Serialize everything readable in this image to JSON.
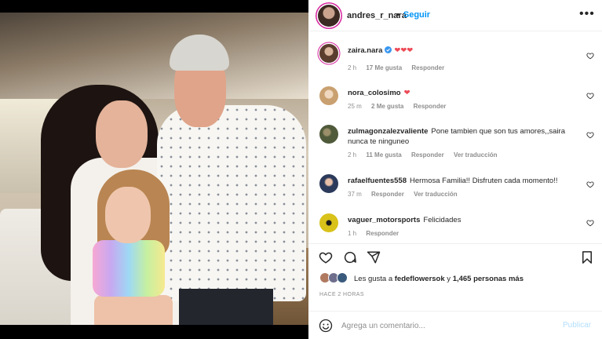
{
  "post": {
    "author": "andres_r_nara",
    "follow_label": "Seguir",
    "more_label": "•••"
  },
  "comments": [
    {
      "username": "zaira.nara",
      "text": "❤❤❤",
      "verified": true,
      "time": "2 h",
      "likes": "17 Me gusta",
      "reply": "Responder",
      "translate": ""
    },
    {
      "username": "nora_colosimo",
      "text": "❤",
      "verified": false,
      "time": "25 m",
      "likes": "2 Me gusta",
      "reply": "Responder",
      "translate": ""
    },
    {
      "username": "zulmagonzalezvaliente",
      "text": "Pone tambien que son tus amores,,saira nunca te ninguneo",
      "verified": false,
      "time": "2 h",
      "likes": "11 Me gusta",
      "reply": "Responder",
      "translate": "Ver traducción"
    },
    {
      "username": "rafaelfuentes558",
      "text": "Hermosa Familia!! Disfruten cada momento!!",
      "verified": false,
      "time": "37 m",
      "likes": "",
      "reply": "Responder",
      "translate": "Ver traducción"
    },
    {
      "username": "vaguer_motorsports",
      "text": "Felicidades",
      "verified": false,
      "time": "1 h",
      "likes": "",
      "reply": "Responder",
      "translate": ""
    }
  ],
  "likes": {
    "prefix": "Les gusta a",
    "user": "fedeflowersok",
    "conjunction": "y",
    "count": "1,465 personas más"
  },
  "timestamp": "HACE 2 HORAS",
  "composer": {
    "placeholder": "Agrega un comentario...",
    "publish_label": "Publicar"
  },
  "colors": {
    "link_blue": "#0095f6",
    "heart_red": "#ed4956",
    "publish_disabled": "#b2dffc",
    "muted_text": "#8e8e8e"
  },
  "icons": [
    "more-icon",
    "heart-icon",
    "comment-icon",
    "share-icon",
    "bookmark-icon",
    "emoji-icon",
    "verified-badge-icon"
  ]
}
